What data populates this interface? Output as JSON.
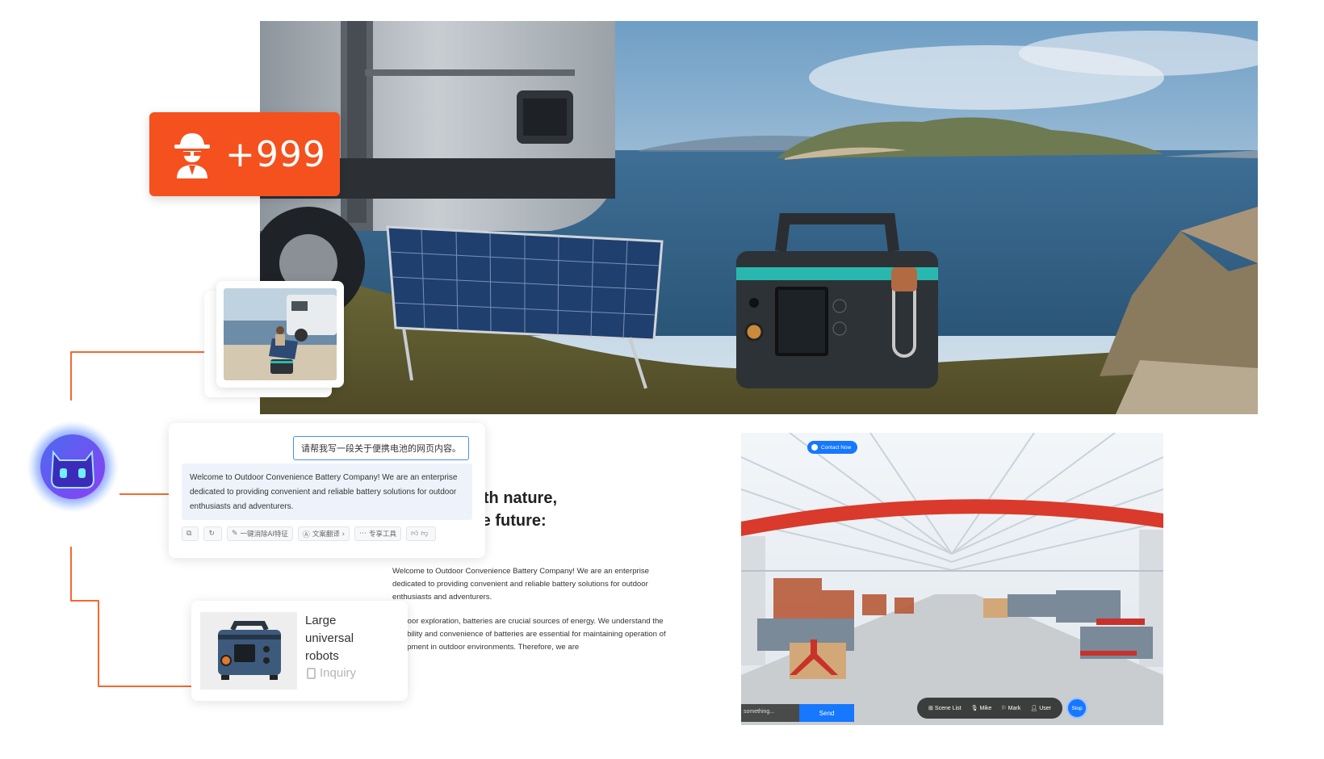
{
  "badge": {
    "count": "+999",
    "icon": "spy-icon"
  },
  "chat": {
    "prompt": "请帮我写一段关于便携电池的网页内容。",
    "reply": "Welcome to Outdoor Convenience Battery Company! We are an enterprise dedicated to providing convenient and reliable battery solutions for outdoor enthusiasts and adventurers.",
    "tools": [
      {
        "icon": "copy-icon",
        "label": ""
      },
      {
        "icon": "refresh-icon",
        "label": ""
      },
      {
        "icon": "edit-icon",
        "label": "一键消除AI特征"
      },
      {
        "icon": "translate-icon",
        "label": "文案翻译 ›"
      },
      {
        "icon": "more-icon",
        "label": "专享工具"
      },
      {
        "icon": "thumbs-up-icon",
        "label": ""
      },
      {
        "icon": "thumbs-down-icon",
        "label": ""
      }
    ]
  },
  "article": {
    "headline_line1": "g with nature,",
    "headline_line2": "g the future:",
    "paragraph1": "Welcome to Outdoor Convenience Battery Company! We are an enterprise dedicated to providing convenient and reliable battery solutions for outdoor enthusiasts and adventurers.",
    "paragraph2": "outdoor exploration, batteries are crucial sources of energy. We understand the reliability and convenience of batteries are essential for maintaining operation of equipment in outdoor environments. Therefore, we are"
  },
  "product": {
    "title": "Large universal robots",
    "inquiry_label": "Inquiry"
  },
  "vr": {
    "contact_label": "Contact Now",
    "input_placeholder": "something...",
    "send_label": "Send",
    "toolbar": [
      {
        "icon": "scene-list-icon",
        "label": "Scene List"
      },
      {
        "icon": "mic-icon",
        "label": "Mike"
      },
      {
        "icon": "mark-icon",
        "label": "Mark"
      },
      {
        "icon": "user-icon",
        "label": "User"
      }
    ],
    "stop_label": "Stop"
  },
  "colors": {
    "accent": "#f4511e",
    "connector": "#f26a2e",
    "vr_blue": "#1677ff"
  }
}
